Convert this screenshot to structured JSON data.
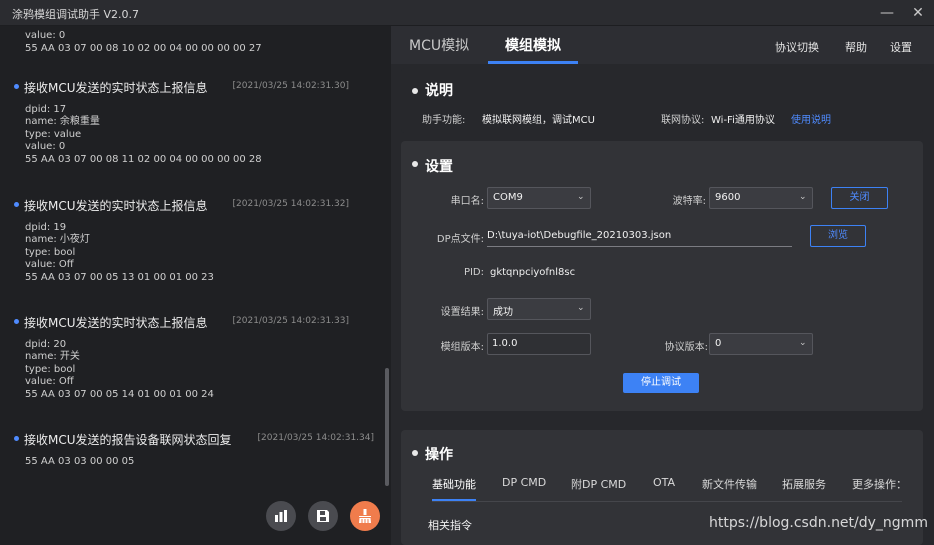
{
  "app": {
    "title": "涂鸦模组调试助手 V2.0.7"
  },
  "window": {
    "minimize": "—",
    "close": "✕"
  },
  "log": {
    "top_lines": [
      "value: 0",
      "55 AA 03 07 00 08 10 02 00 04 00 00 00 00 27"
    ],
    "entries": [
      {
        "title": "接收MCU发送的实时状态上报信息",
        "time": "[2021/03/25 14:02:31.30]",
        "lines": [
          "dpid: 17",
          "name: 余粮重量",
          "type: value",
          "value: 0",
          "55 AA 03 07 00 08 11 02 00 04 00 00 00 00 28"
        ]
      },
      {
        "title": "接收MCU发送的实时状态上报信息",
        "time": "[2021/03/25 14:02:31.32]",
        "lines": [
          "dpid: 19",
          "name: 小夜灯",
          "type: bool",
          "value: Off",
          "55 AA 03 07 00 05 13 01 00 01 00 23"
        ]
      },
      {
        "title": "接收MCU发送的实时状态上报信息",
        "time": "[2021/03/25 14:02:31.33]",
        "lines": [
          "dpid: 20",
          "name: 开关",
          "type: bool",
          "value: Off",
          "55 AA 03 07 00 05 14 01 00 01 00 24"
        ]
      },
      {
        "title": "接收MCU发送的报告设备联网状态回复",
        "time": "[2021/03/25 14:02:31.34]",
        "lines": [
          "55 AA 03 03 00 00 05"
        ]
      }
    ]
  },
  "tabs": {
    "mcu": "MCU模拟",
    "module": "模组模拟"
  },
  "top_links": {
    "protocol": "协议切换",
    "help": "帮助",
    "settings": "设置"
  },
  "info": {
    "title": "说明",
    "func_label": "助手功能:",
    "func_value": "模拟联网模组，调试MCU",
    "net_label": "联网协议:",
    "net_value": "Wi-Fi通用协议",
    "usage_link": "使用说明"
  },
  "settings": {
    "title": "设置",
    "port_label": "串口名:",
    "port_value": "COM9",
    "baud_label": "波特率:",
    "baud_value": "9600",
    "close_btn": "关闭",
    "dp_label": "DP点文件:",
    "dp_value": "D:\\tuya-iot\\Debugfile_20210303.json",
    "browse_btn": "浏览",
    "pid_label": "PID:",
    "pid_value": "gktqnpciyofnl8sc",
    "result_label": "设置结果:",
    "result_value": "成功",
    "module_ver_label": "模组版本:",
    "module_ver_value": "1.0.0",
    "proto_ver_label": "协议版本:",
    "proto_ver_value": "0",
    "stop_btn": "停止调试"
  },
  "operations": {
    "title": "操作",
    "tabs": [
      "基础功能",
      "DP CMD",
      "附DP CMD",
      "OTA",
      "新文件传输",
      "拓展服务",
      "更多操作："
    ],
    "sub_title": "相关指令"
  },
  "watermark": "https://blog.csdn.net/dy_ngmm",
  "colors": {
    "accent": "#3d82f5",
    "clear_button": "#f07c4c"
  }
}
